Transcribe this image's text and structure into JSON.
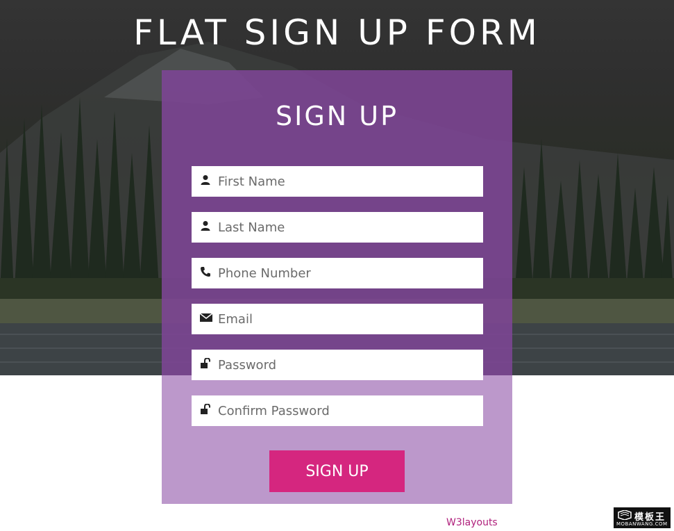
{
  "page": {
    "title": "FLAT SIGN UP FORM"
  },
  "form": {
    "title": "SIGN UP",
    "fields": [
      {
        "placeholder": "First Name",
        "icon": "user-icon"
      },
      {
        "placeholder": "Last Name",
        "icon": "user-icon"
      },
      {
        "placeholder": "Phone Number",
        "icon": "phone-icon"
      },
      {
        "placeholder": "Email",
        "icon": "envelope-icon"
      },
      {
        "placeholder": "Password",
        "icon": "unlock-icon"
      },
      {
        "placeholder": "Confirm Password",
        "icon": "unlock-icon"
      }
    ],
    "submit_label": "SIGN UP"
  },
  "footer": {
    "credit": "W3layouts"
  },
  "watermark": {
    "brand": "模板王",
    "site": "MOBANWANG.COM"
  },
  "colors": {
    "panel": "#a675ba",
    "button": "#d5267f",
    "link": "#b0217c",
    "text_light": "#ffffff"
  }
}
